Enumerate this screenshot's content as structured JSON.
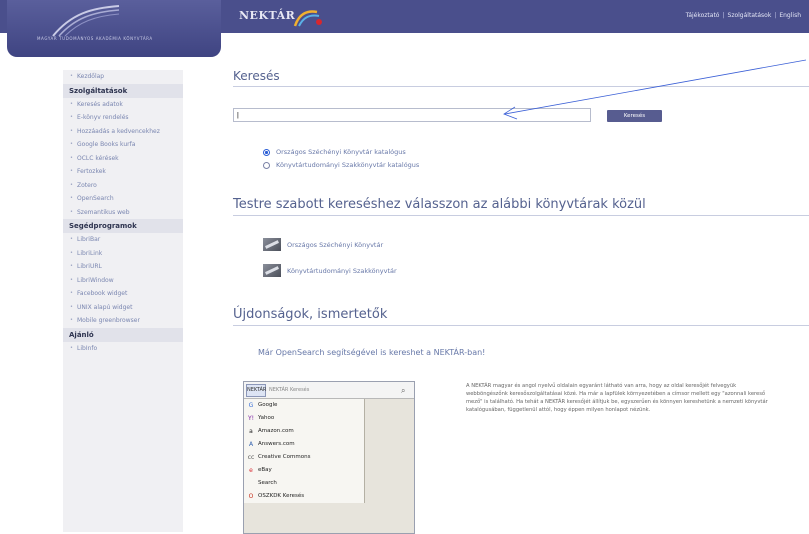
{
  "header": {
    "logo_text": "Magyar Tudományos Akadémia Könyvtára",
    "brand": "NEKTÁR",
    "links": [
      "Tájékoztató",
      "Szolgáltatások",
      "English"
    ]
  },
  "sidebar": {
    "items": [
      {
        "type": "item",
        "label": "Kezdőlap"
      },
      {
        "type": "head",
        "label": "Szolgáltatások"
      },
      {
        "type": "item",
        "label": "Keresés adatok"
      },
      {
        "type": "item",
        "label": "E-könyv rendelés"
      },
      {
        "type": "item",
        "label": "Hozzáadás a kedvencekhez"
      },
      {
        "type": "item",
        "label": "Google Books kurfa"
      },
      {
        "type": "item",
        "label": "OCLC kérések"
      },
      {
        "type": "item",
        "label": "Fertozkek"
      },
      {
        "type": "item",
        "label": "Zotero"
      },
      {
        "type": "item",
        "label": "OpenSearch"
      },
      {
        "type": "item",
        "label": "Szemantikus web"
      },
      {
        "type": "head",
        "label": "Segédprogramok"
      },
      {
        "type": "item",
        "label": "LibriBar"
      },
      {
        "type": "item",
        "label": "LibriLink"
      },
      {
        "type": "item",
        "label": "LibriURL"
      },
      {
        "type": "item",
        "label": "LibriWindow"
      },
      {
        "type": "item",
        "label": "Facebook widget"
      },
      {
        "type": "item",
        "label": "UNIX alapú widget"
      },
      {
        "type": "item",
        "label": "Mobile greenbrowser"
      },
      {
        "type": "head",
        "label": "Ajánló"
      },
      {
        "type": "item",
        "label": "LibInfo"
      }
    ]
  },
  "search": {
    "title": "Keresés",
    "input_value": "|",
    "button": "Keresés",
    "options": [
      {
        "label": "Országos Széchényi Könyvtár katalógus",
        "selected": true
      },
      {
        "label": "Könyvtártudományi Szakkönyvtár katalógus",
        "selected": false
      }
    ]
  },
  "libraries": {
    "title": "Testre szabott kereséshez válasszon az alábbi könyvtárak közül",
    "items": [
      "Országos Széchényi Könyvtár",
      "Könyvtártudományi Szakkönyvtár"
    ]
  },
  "news": {
    "title": "Újdonságok, ismertetők",
    "subtitle": "Már OpenSearch segítségével is kereshet a NEKTÁR-ban!",
    "opensearch": {
      "engine_label": "NEKTÁR",
      "field_placeholder": "NEKTÁR Keresés",
      "engines": [
        {
          "label": "Google",
          "icon": "google-icon",
          "color": "#3a6fd8",
          "glyph": "G"
        },
        {
          "label": "Yahoo",
          "icon": "yahoo-icon",
          "color": "#7a1fa2",
          "glyph": "Y!"
        },
        {
          "label": "Amazon.com",
          "icon": "amazon-icon",
          "color": "#222222",
          "glyph": "a"
        },
        {
          "label": "Answers.com",
          "icon": "answers-icon",
          "color": "#2f5fae",
          "glyph": "A"
        },
        {
          "label": "Creative Commons",
          "icon": "cc-icon",
          "color": "#555555",
          "glyph": "cc"
        },
        {
          "label": "eBay",
          "icon": "ebay-icon",
          "color": "#d8262d",
          "glyph": "e"
        },
        {
          "label": "Search",
          "icon": "search-icon",
          "color": "#666666",
          "glyph": ""
        },
        {
          "label": "OSZKDK Keresés",
          "icon": "oszk-icon",
          "color": "#c7311f",
          "glyph": "O"
        }
      ]
    },
    "description": "A NEKTÁR magyar és angol nyelvű oldalain egyaránt látható van arra, hogy az oldal keresőjét felvegyük webböngészőnk keresőszolgáltatásai közé. Ha már a lapfülek környezetében a címsor mellett egy \"azonnali kereső mező\" is található. Ha tehát a NEKTÁR keresőjét állítjuk be, egyszerűen és könnyen kereshetünk a nemzeti könyvtár katalógusában, függetlenül attól, hogy éppen milyen honlapot nézünk."
  }
}
